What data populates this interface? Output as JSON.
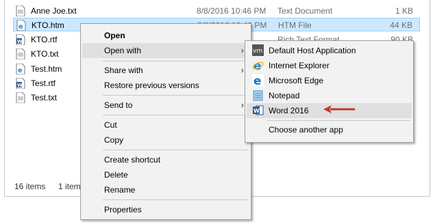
{
  "files": [
    {
      "name": "Anne Joe.txt",
      "date": "8/8/2016 10:46 PM",
      "type": "Text Document",
      "size": "1 KB",
      "icon": "text-file-icon"
    },
    {
      "name": "KTO.htm",
      "date": "8/8/2016 10:46 PM",
      "type": "HTM File",
      "size": "44 KB",
      "icon": "html-file-icon",
      "selected": true
    },
    {
      "name": "KTO.rtf",
      "date": "",
      "type": "Rich Text Format",
      "size": "90 KB",
      "icon": "word-file-icon"
    },
    {
      "name": "KTO.txt",
      "date": "",
      "type": "",
      "size": "",
      "icon": "text-file-icon"
    },
    {
      "name": "Test.htm",
      "date": "",
      "type": "",
      "size": "",
      "icon": "html-file-icon"
    },
    {
      "name": "Test.rtf",
      "date": "",
      "type": "",
      "size": "",
      "icon": "word-file-icon"
    },
    {
      "name": "Test.txt",
      "date": "",
      "type": "",
      "size": "",
      "icon": "text-file-icon"
    }
  ],
  "status": {
    "items": "16 items",
    "selected": "1 item"
  },
  "context_menu": {
    "open": "Open",
    "open_with": "Open with",
    "share_with": "Share with",
    "restore": "Restore previous versions",
    "send_to": "Send to",
    "cut": "Cut",
    "copy": "Copy",
    "create_shortcut": "Create shortcut",
    "delete": "Delete",
    "rename": "Rename",
    "properties": "Properties"
  },
  "submenu": [
    {
      "label": "Default Host Application",
      "icon": "vm-icon"
    },
    {
      "label": "Internet Explorer",
      "icon": "internet-explorer-icon"
    },
    {
      "label": "Microsoft Edge",
      "icon": "edge-icon"
    },
    {
      "label": "Notepad",
      "icon": "notepad-icon"
    },
    {
      "label": "Word 2016",
      "icon": "word-icon"
    },
    {
      "label": "Choose another app",
      "icon": ""
    }
  ],
  "colors": {
    "selection": "#cce8ff",
    "arrow": "#c0392b",
    "word_blue": "#2b579a",
    "ie_blue": "#1e88e5"
  }
}
